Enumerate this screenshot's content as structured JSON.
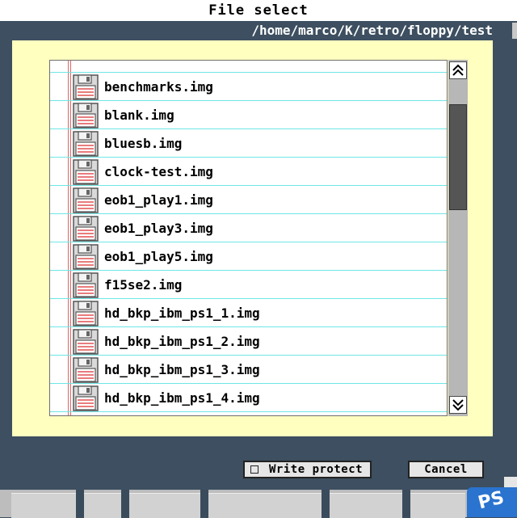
{
  "window": {
    "title": "File select",
    "path": "/home/marco/K/retro/floppy/test"
  },
  "files": [
    {
      "name": ""
    },
    {
      "name": "benchmarks.img"
    },
    {
      "name": "blank.img"
    },
    {
      "name": "bluesb.img"
    },
    {
      "name": "clock-test.img"
    },
    {
      "name": "eob1_play1.img"
    },
    {
      "name": "eob1_play3.img"
    },
    {
      "name": "eob1_play5.img"
    },
    {
      "name": "f15se2.img"
    },
    {
      "name": "hd_bkp_ibm_ps1_1.img"
    },
    {
      "name": "hd_bkp_ibm_ps1_2.img"
    },
    {
      "name": "hd_bkp_ibm_ps1_3.img"
    },
    {
      "name": "hd_bkp_ibm_ps1_4.img"
    }
  ],
  "buttons": {
    "write_protect": "Write protect",
    "write_protect_checked": false,
    "cancel": "Cancel"
  },
  "scrollbar": {
    "position_fraction": 0.0
  },
  "icons": {
    "file": "floppy-disk-icon",
    "scroll_up": "double-chevron-up-icon",
    "scroll_down": "double-chevron-down-icon"
  },
  "colors": {
    "panel": "#ffffc0",
    "background": "#3d4f60",
    "row_separator": "#6fe6e6",
    "badge": "#2a73cf"
  },
  "badge": {
    "text": "PS"
  }
}
